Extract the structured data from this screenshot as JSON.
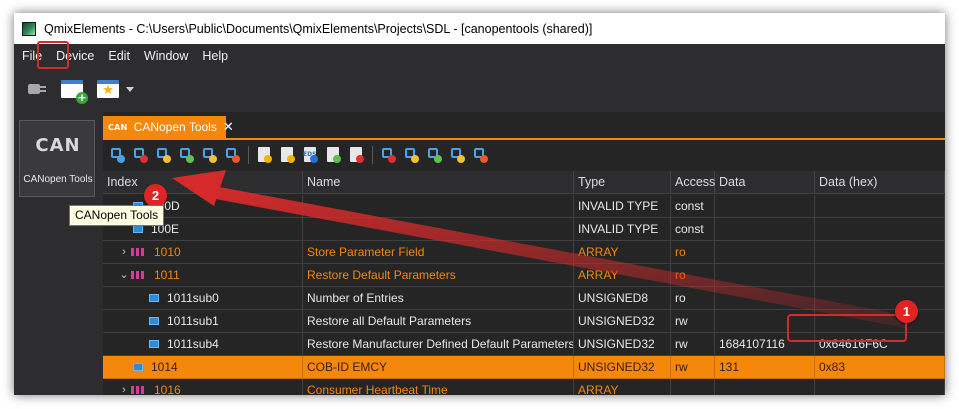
{
  "window": {
    "title": "QmixElements - C:\\Users\\Public\\Documents\\QmixElements\\Projects\\SDL - [canopentools (shared)]"
  },
  "menu": [
    "File",
    "Device",
    "Edit",
    "Window",
    "Help"
  ],
  "main_toolbar": {
    "icons": [
      "plug-icon",
      "window-add-icon",
      "window-favorite-icon",
      "dropdown-arrow-icon"
    ]
  },
  "left_panel": {
    "plugin_logo": "CAN",
    "plugin_label": "CANopen Tools"
  },
  "tooltip": "CANopen Tools",
  "tab": {
    "icon_text": "CAN",
    "label": "CANopen Tools"
  },
  "plugin_toolbar": {
    "icons": [
      {
        "name": "network-scan-icon",
        "color": "#4aa3e8"
      },
      {
        "name": "network-stop-icon",
        "color": "#e03030"
      },
      {
        "name": "network-info-icon",
        "color": "#f2c230"
      },
      {
        "name": "network-add-icon",
        "color": "#5cc24a"
      },
      {
        "name": "network-warning-icon",
        "color": "#f2c230"
      },
      {
        "name": "network-remove-icon",
        "color": "#e85a2a"
      },
      {
        "name": "edit-icon",
        "color": "#f2b400"
      },
      {
        "name": "document-load-icon",
        "color": "#f2b400"
      },
      {
        "name": "eds-file-icon",
        "color": "#2a6fd1"
      },
      {
        "name": "document-import-icon",
        "color": "#5cc24a"
      },
      {
        "name": "document-export-icon",
        "color": "#e03030"
      },
      {
        "name": "device-stop-icon",
        "color": "#e03030"
      },
      {
        "name": "device-info-icon",
        "color": "#f2c230"
      },
      {
        "name": "device-add-icon",
        "color": "#5cc24a"
      },
      {
        "name": "device-warning-icon",
        "color": "#f2c230"
      },
      {
        "name": "device-remove-icon",
        "color": "#e85a2a"
      }
    ]
  },
  "table": {
    "columns": [
      "Index",
      "Name",
      "Type",
      "Access",
      "Data",
      "Data (hex)"
    ],
    "rows": [
      {
        "index": "100D",
        "name": "",
        "type": "INVALID TYPE",
        "access": "const",
        "data": "",
        "hex": "",
        "kind": "leaf",
        "level": 1
      },
      {
        "index": "100E",
        "name": "",
        "type": "INVALID TYPE",
        "access": "const",
        "data": "",
        "hex": "",
        "kind": "leaf",
        "level": 1
      },
      {
        "index": "1010",
        "name": "Store Parameter Field",
        "type": "ARRAY",
        "access": "ro",
        "data": "",
        "hex": "",
        "kind": "record",
        "expander": "›",
        "level": 1
      },
      {
        "index": "1011",
        "name": "Restore Default Parameters",
        "type": "ARRAY",
        "access": "ro",
        "data": "",
        "hex": "",
        "kind": "record",
        "expander": "⌄",
        "level": 1
      },
      {
        "index": "1011sub0",
        "name": "Number of Entries",
        "type": "UNSIGNED8",
        "access": "ro",
        "data": "",
        "hex": "",
        "kind": "leaf",
        "level": 2
      },
      {
        "index": "1011sub1",
        "name": "Restore all Default Parameters",
        "type": "UNSIGNED32",
        "access": "rw",
        "data": "",
        "hex": "",
        "kind": "leaf",
        "level": 2
      },
      {
        "index": "1011sub4",
        "name": "Restore Manufacturer Defined Default Parameters",
        "type": "UNSIGNED32",
        "access": "rw",
        "data": "1684107116",
        "hex": "0x64616F6C",
        "kind": "leaf",
        "level": 2
      },
      {
        "index": "1014",
        "name": "COB-ID EMCY",
        "type": "UNSIGNED32",
        "access": "rw",
        "data": "131",
        "hex": "0x83",
        "kind": "leaf",
        "level": 1,
        "selected": true
      },
      {
        "index": "1016",
        "name": "Consumer Heartbeat Time",
        "type": "ARRAY",
        "access": "",
        "data": "",
        "hex": "",
        "kind": "record",
        "expander": "›",
        "level": 1
      }
    ]
  },
  "annotations": {
    "badge_1": "1",
    "badge_2": "2",
    "arrow_color": "#d42a2a"
  },
  "colors": {
    "accent": "#f5870a",
    "highlight": "#d42a2a"
  }
}
